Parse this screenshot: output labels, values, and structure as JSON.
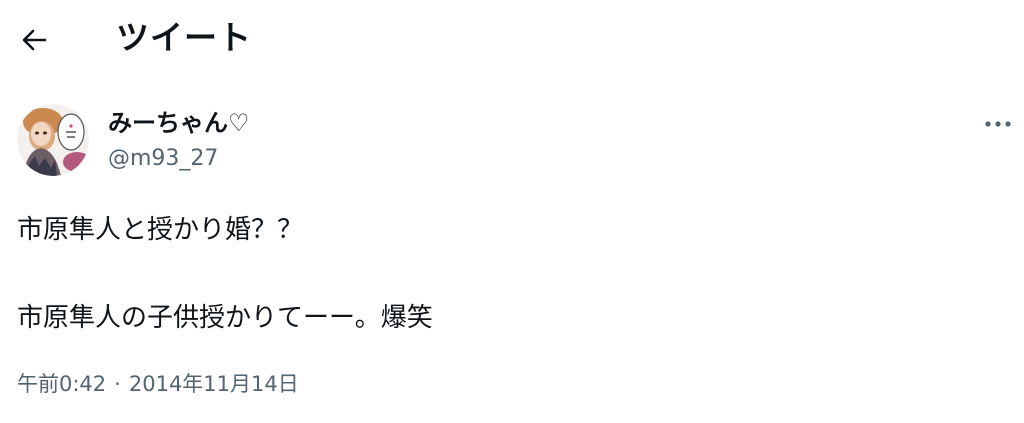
{
  "header": {
    "title": "ツイート",
    "back_icon": "arrow-left-icon"
  },
  "author": {
    "display_name": "みーちゃん♡",
    "handle": "@m93_27"
  },
  "tweet": {
    "line1": "市原隼人と授かり婚？？",
    "line2": "市原隼人の子供授かりてーー。爆笑"
  },
  "meta": {
    "time": "午前0:42",
    "separator": "·",
    "date": "2014年11月14日"
  },
  "icons": {
    "more": "more-dots-icon"
  },
  "colors": {
    "text": "#0f1419",
    "secondary": "#536471",
    "background": "#ffffff"
  }
}
